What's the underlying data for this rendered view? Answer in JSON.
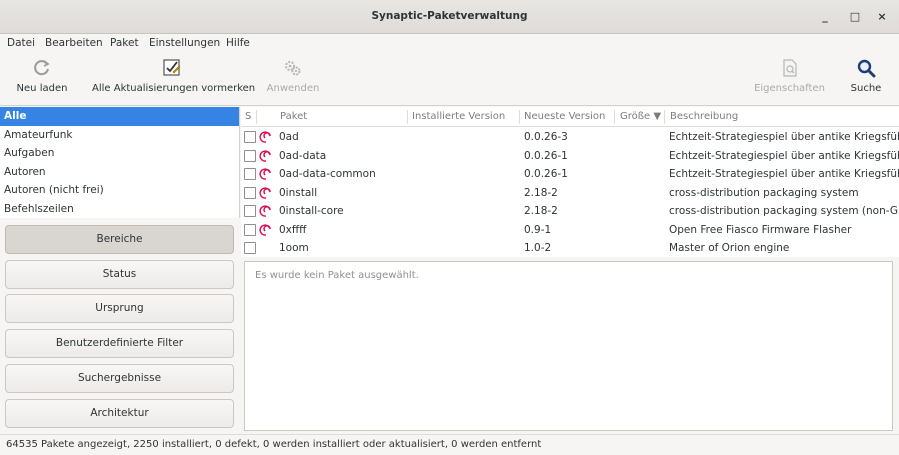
{
  "window": {
    "title": "Synaptic-Paketverwaltung",
    "minimize": "_",
    "maximize": "□",
    "close": "×"
  },
  "menu": [
    "Datei",
    "Bearbeiten",
    "Paket",
    "Einstellungen",
    "Hilfe"
  ],
  "toolbar": {
    "reload": "Neu laden",
    "mark_all": "Alle Aktualisierungen vormerken",
    "apply": "Anwenden",
    "properties": "Eigenschaften",
    "search": "Suche"
  },
  "sections": [
    "Alle",
    "Amateurfunk",
    "Aufgaben",
    "Autoren",
    "Autoren (nicht frei)",
    "Befehlszeilen"
  ],
  "filters": [
    "Bereiche",
    "Status",
    "Ursprung",
    "Benutzerdefinierte Filter",
    "Suchergebnisse",
    "Architektur"
  ],
  "columns": {
    "s": "S",
    "package": "Paket",
    "installed": "Installierte Version",
    "latest": "Neueste Version",
    "size": "Größe ▼",
    "description": "Beschreibung"
  },
  "packages": [
    {
      "name": "0ad",
      "installed": "",
      "latest": "0.0.26-3",
      "desc": "Echtzeit-Strategiespiel über antike Kriegsführung"
    },
    {
      "name": "0ad-data",
      "installed": "",
      "latest": "0.0.26-1",
      "desc": "Echtzeit-Strategiespiel über antike Kriegsführung"
    },
    {
      "name": "0ad-data-common",
      "installed": "",
      "latest": "0.0.26-1",
      "desc": "Echtzeit-Strategiespiel über antike Kriegsführung"
    },
    {
      "name": "0install",
      "installed": "",
      "latest": "2.18-2",
      "desc": "cross-distribution packaging system"
    },
    {
      "name": "0install-core",
      "installed": "",
      "latest": "2.18-2",
      "desc": "cross-distribution packaging system (non-GUI pa"
    },
    {
      "name": "0xffff",
      "installed": "",
      "latest": "0.9-1",
      "desc": "Open Free Fiasco Firmware Flasher"
    },
    {
      "name": "1oom",
      "installed": "",
      "latest": "1.0-2",
      "desc": "Master of Orion engine"
    }
  ],
  "details_placeholder": "Es wurde kein Paket ausgewählt.",
  "status": "64535 Pakete angezeigt, 2250 installiert, 0 defekt, 0 werden installiert oder aktualisiert, 0 werden entfernt",
  "colors": {
    "selection": "#3584e4",
    "debian": "#d70a53"
  }
}
